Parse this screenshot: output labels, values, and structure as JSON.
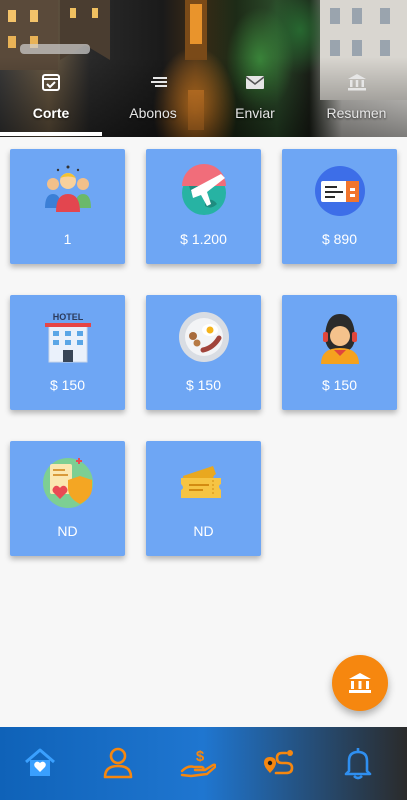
{
  "tabs": [
    {
      "label": "Corte",
      "icon": "check-calendar-icon",
      "active": true
    },
    {
      "label": "Abonos",
      "icon": "list-icon",
      "active": false
    },
    {
      "label": "Enviar",
      "icon": "mail-icon",
      "active": false
    },
    {
      "label": "Resumen",
      "icon": "bank-icon",
      "active": false
    }
  ],
  "cards": [
    {
      "icon": "people-group-icon",
      "value": "1"
    },
    {
      "icon": "airplane-globe-icon",
      "value": "$ 1.200"
    },
    {
      "icon": "flight-ticket-icon",
      "value": "$ 890"
    },
    {
      "icon": "hotel-icon",
      "value": "$ 150"
    },
    {
      "icon": "breakfast-plate-icon",
      "value": "$ 150"
    },
    {
      "icon": "tour-guide-icon",
      "value": "$ 150"
    },
    {
      "icon": "health-insurance-icon",
      "value": "ND"
    },
    {
      "icon": "tickets-icon",
      "value": "ND"
    }
  ],
  "fab": {
    "icon": "bank-icon"
  },
  "bottom_nav": [
    {
      "icon": "home-icon"
    },
    {
      "icon": "user-icon"
    },
    {
      "icon": "payment-hand-icon"
    },
    {
      "icon": "route-icon"
    },
    {
      "icon": "bell-icon"
    }
  ],
  "colors": {
    "card": "#6ea6f4",
    "fab": "#f6870f",
    "nav_active": "#2f8ff0",
    "nav_icon": "#f6870f"
  }
}
